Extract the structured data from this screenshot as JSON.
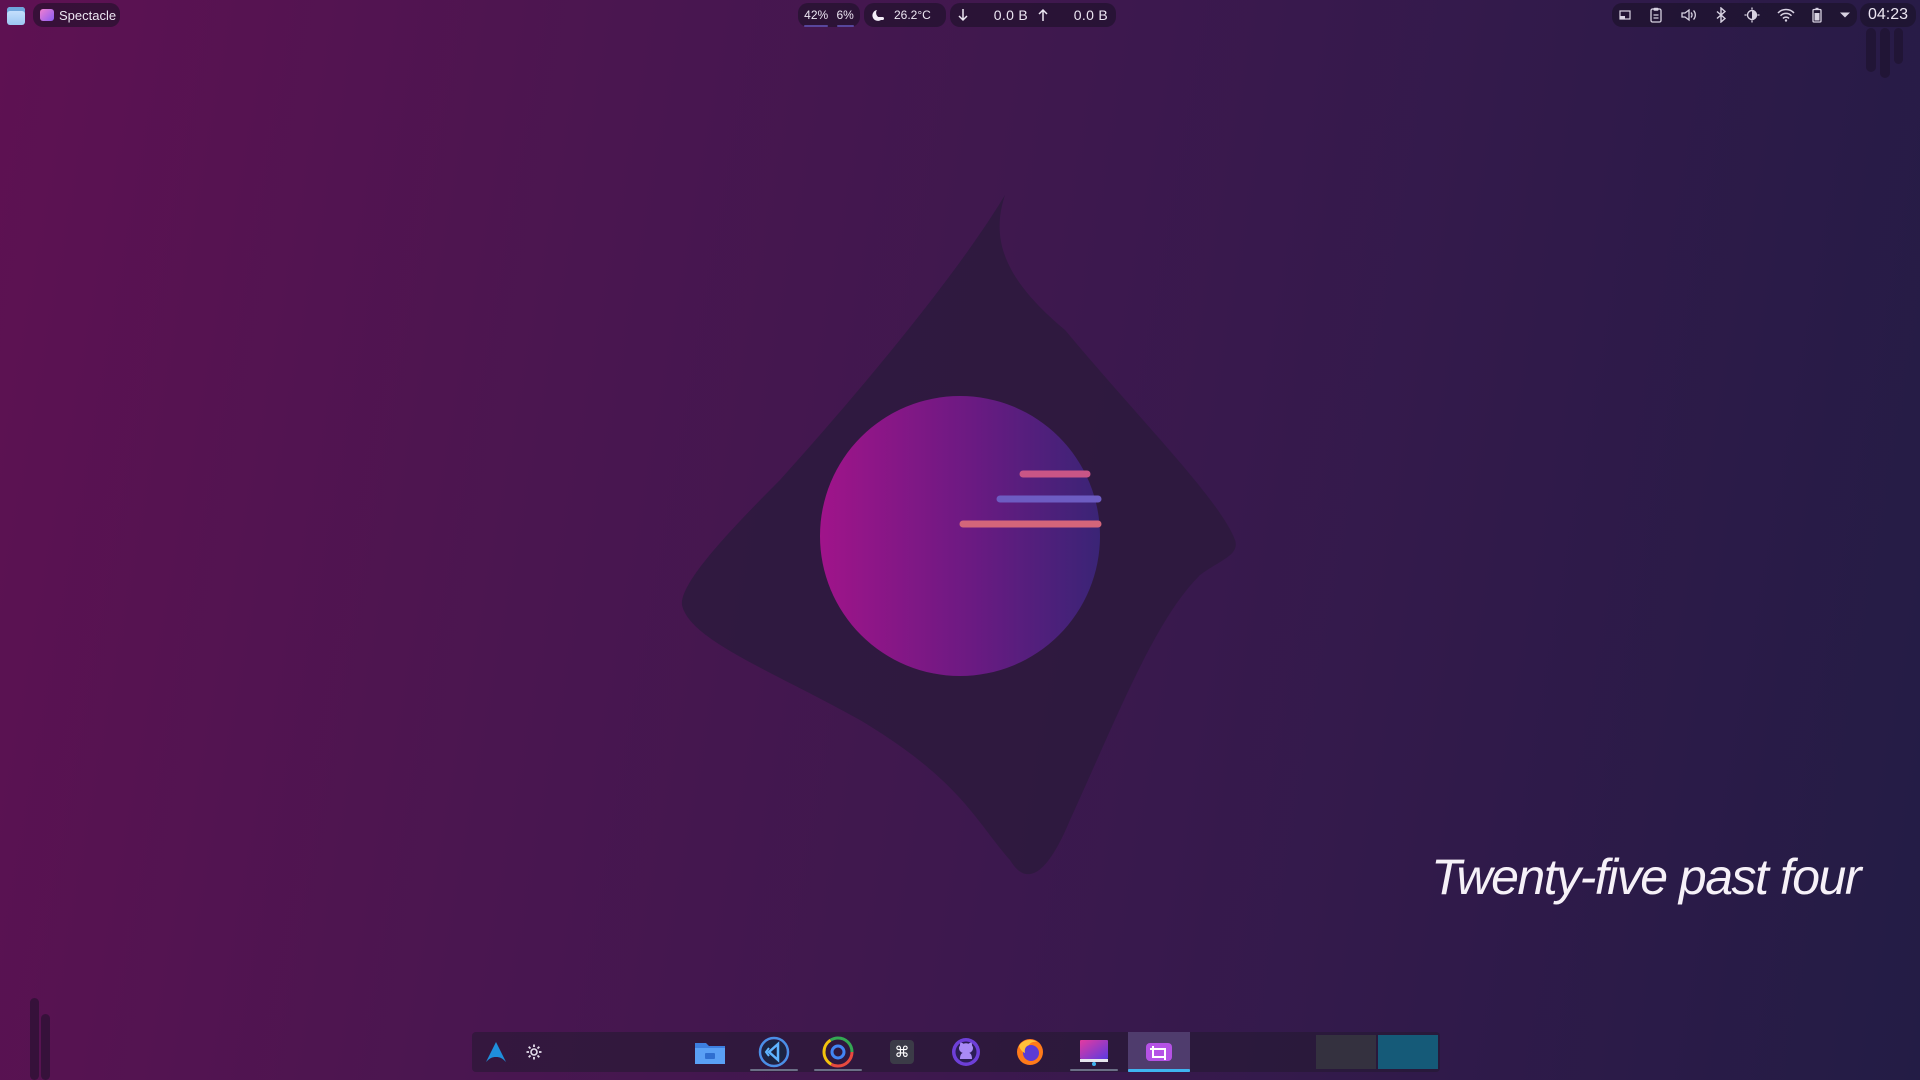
{
  "topbar": {
    "active_window": "Spectacle",
    "cpu": "42%",
    "ram": "6%",
    "temperature": "26.2°C",
    "net_down": "0.0 B",
    "net_up": "0.0 B",
    "clock": "04:23",
    "tray_icons": [
      "panel-icon",
      "clipboard-icon",
      "volume-icon",
      "bluetooth-icon",
      "brightness-icon",
      "wifi-icon",
      "battery-icon",
      "expand-tray-icon"
    ]
  },
  "desktop": {
    "time_in_words": "Twenty-five past four"
  },
  "dock": {
    "launchers": [
      "arch-menu-icon",
      "settings-icon"
    ],
    "apps": [
      {
        "name": "files-icon",
        "running": false
      },
      {
        "name": "vscode-icon",
        "running": true
      },
      {
        "name": "chrome-icon",
        "running": true
      },
      {
        "name": "terminal-icon",
        "running": false
      },
      {
        "name": "github-desktop-icon",
        "running": false
      },
      {
        "name": "firefox-icon",
        "running": false
      },
      {
        "name": "display-icon",
        "running": true
      },
      {
        "name": "spectacle-icon",
        "running": true,
        "active": true
      }
    ],
    "pager": {
      "desktop_count": 2,
      "active_desktop": 2
    }
  },
  "colors": {
    "accent": "#3fb4f0",
    "wallpaper_left": "#5e1152",
    "wallpaper_right": "#231c45"
  }
}
